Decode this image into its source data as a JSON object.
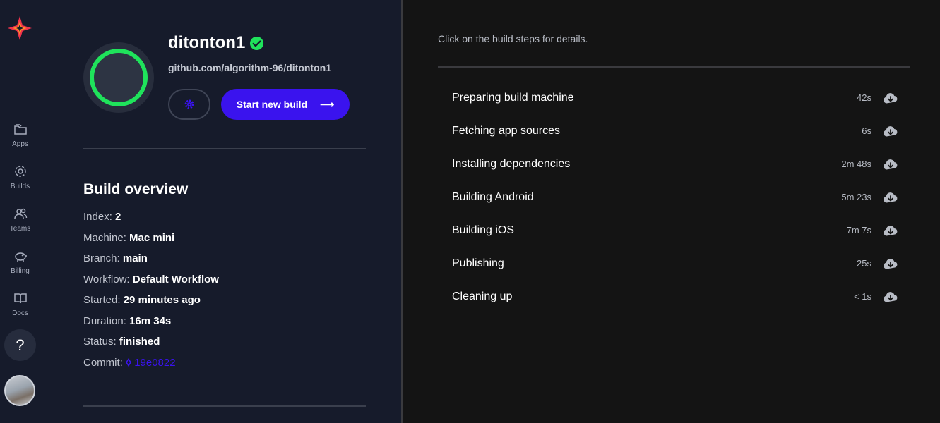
{
  "sidebar": {
    "logo": "codemagic-logo-icon",
    "items": [
      {
        "label": "Apps",
        "icon": "folder-icon"
      },
      {
        "label": "Builds",
        "icon": "builds-icon"
      },
      {
        "label": "Teams",
        "icon": "users-icon"
      },
      {
        "label": "Billing",
        "icon": "piggy-bank-icon"
      },
      {
        "label": "Docs",
        "icon": "book-icon"
      }
    ],
    "help_label": "?"
  },
  "app": {
    "name": "ditonton1",
    "repo": "github.com/algorithm-96/ditonton1",
    "start_build_label": "Start new build",
    "status_ring_color": "#1fe35b"
  },
  "overview": {
    "title": "Build overview",
    "rows": [
      {
        "label": "Index:",
        "value": "2"
      },
      {
        "label": "Machine:",
        "value": "Mac mini"
      },
      {
        "label": "Branch:",
        "value": "main"
      },
      {
        "label": "Workflow:",
        "value": "Default Workflow"
      },
      {
        "label": "Started:",
        "value": "29 minutes ago"
      },
      {
        "label": "Duration:",
        "value": "16m 34s"
      },
      {
        "label": "Status:",
        "value": "finished"
      },
      {
        "label": "Commit:",
        "value": "19e0822"
      }
    ]
  },
  "build_steps": {
    "hint": "Click on the build steps for details.",
    "steps": [
      {
        "name": "Preparing build machine",
        "duration": "42s"
      },
      {
        "name": "Fetching app sources",
        "duration": "6s"
      },
      {
        "name": "Installing dependencies",
        "duration": "2m 48s"
      },
      {
        "name": "Building Android",
        "duration": "5m 23s"
      },
      {
        "name": "Building iOS",
        "duration": "7m 7s"
      },
      {
        "name": "Publishing",
        "duration": "25s"
      },
      {
        "name": "Cleaning up",
        "duration": "< 1s"
      }
    ]
  },
  "colors": {
    "accent": "#3a13ee",
    "success": "#1fe35b",
    "panel": "#161b2b",
    "background": "#141414"
  }
}
